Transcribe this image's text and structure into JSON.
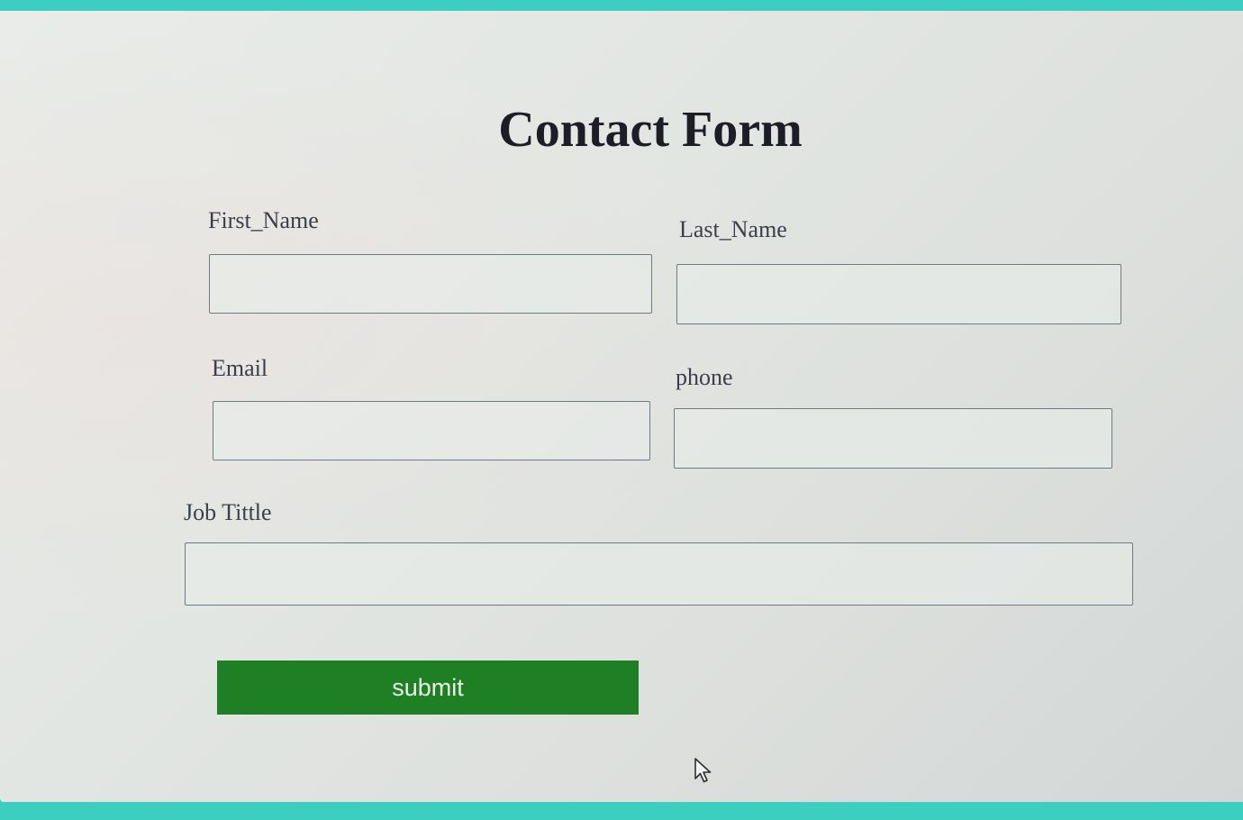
{
  "form": {
    "title": "Contact Form",
    "fields": {
      "first_name": {
        "label": "First_Name",
        "value": ""
      },
      "last_name": {
        "label": "Last_Name",
        "value": ""
      },
      "email": {
        "label": "Email",
        "value": ""
      },
      "phone": {
        "label": "phone",
        "value": ""
      },
      "job_title": {
        "label": "Job Tittle",
        "value": ""
      }
    },
    "submit_label": "submit",
    "submit_color": "#1f7f24"
  },
  "cursor": {
    "icon": "mouse-pointer-icon"
  },
  "colors": {
    "screen_bezel": "#3ccfc0",
    "background": "#e4e8e4",
    "title_text": "#1c1d26",
    "label_text": "#3a3f4a"
  }
}
